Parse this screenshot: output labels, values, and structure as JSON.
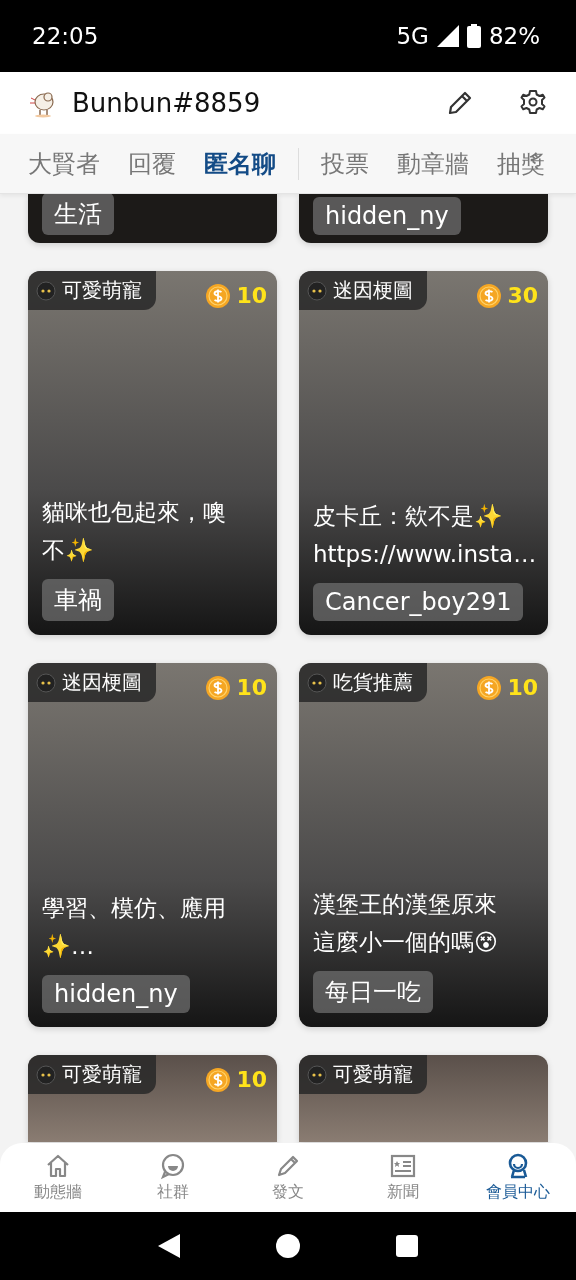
{
  "status_bar": {
    "time": "22:05",
    "network": "5G",
    "battery": "82%"
  },
  "header": {
    "username": "Bunbun#8859"
  },
  "tabs": [
    {
      "label": "大賢者",
      "selected": false
    },
    {
      "label": "回覆",
      "selected": false
    },
    {
      "label": "匿名聊",
      "selected": true
    },
    {
      "label": "投票",
      "selected": false
    },
    {
      "label": "動章牆",
      "selected": false
    },
    {
      "label": "抽獎",
      "selected": false
    }
  ],
  "cards": [
    {
      "kind": "cut-top",
      "author": "生活"
    },
    {
      "kind": "cut-top",
      "author": "hidden_ny"
    },
    {
      "kind": "full",
      "category": "可愛萌寵",
      "coins": "10",
      "title_lines": [
        "貓咪也包起來，噢",
        "不✨"
      ],
      "author": "車禍"
    },
    {
      "kind": "full",
      "category": "迷因梗圖",
      "coins": "30",
      "title_lines": [
        "皮卡丘：欸不是✨",
        "https://www.insta…"
      ],
      "author": "Cancer_boy291"
    },
    {
      "kind": "full",
      "category": "迷因梗圖",
      "coins": "10",
      "title_lines": [
        "學習、模仿、應用",
        "✨…"
      ],
      "author": "hidden_ny"
    },
    {
      "kind": "full",
      "category": "吃貨推薦",
      "coins": "10",
      "title_lines": [
        "漢堡王的漢堡原來",
        "這麼小一個的嗎😵"
      ],
      "author": "每日一吃"
    },
    {
      "kind": "cut-bottom",
      "category": "可愛萌寵",
      "coins": "10"
    },
    {
      "kind": "cut-bottom",
      "category": "可愛萌寵"
    }
  ],
  "bottom_nav": [
    {
      "label": "動態牆",
      "kind": "home",
      "selected": false
    },
    {
      "label": "社群",
      "kind": "chat",
      "selected": false
    },
    {
      "label": "發文",
      "kind": "pencil",
      "selected": false
    },
    {
      "label": "新聞",
      "kind": "news",
      "selected": false
    },
    {
      "label": "會員中心",
      "kind": "member",
      "selected": true
    }
  ]
}
